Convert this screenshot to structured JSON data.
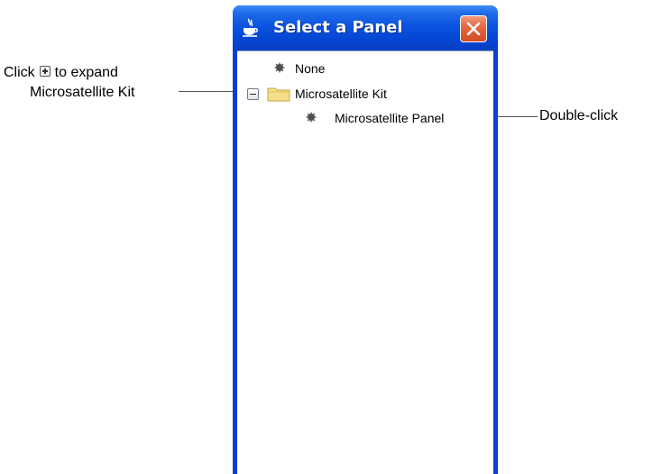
{
  "window": {
    "title": "Select a Panel",
    "app_icon": "java-cup-icon",
    "close_icon": "close-icon"
  },
  "tree": {
    "items": [
      {
        "label": "None",
        "icon": "bullet-icon"
      },
      {
        "label": "Microsatellite Kit",
        "icon": "folder-icon",
        "expander": "collapse-icon",
        "expanded": true
      },
      {
        "label": "Microsatellite Panel",
        "icon": "bullet-icon"
      }
    ]
  },
  "annotations": {
    "expand": {
      "prefix": "Click",
      "icon": "expand-plus-icon",
      "suffix": "to expand",
      "line2": "Microsatellite Kit"
    },
    "double_click": "Double-click"
  },
  "colors": {
    "titlebar": "#0b53e0",
    "close_button": "#e0532a",
    "folder": "#f4e08a",
    "bullet": "#505050"
  }
}
